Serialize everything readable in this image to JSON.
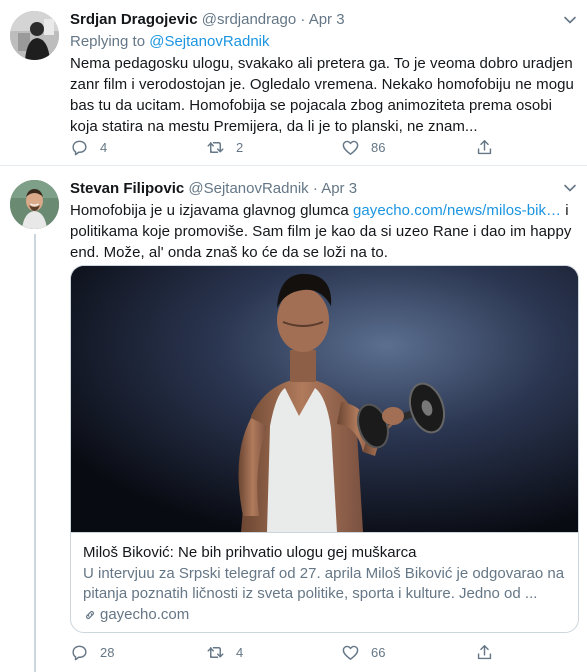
{
  "tweets": [
    {
      "name": "Srdjan Dragojevic",
      "handle": "@srdjandrago",
      "separator": "·",
      "date": "Apr 3",
      "replying_prefix": "Replying to",
      "replying_to": "@SejtanovRadnik",
      "text": "Nema pedagosku ulogu, svakako ali pretera ga. To je veoma dobro uradjen zanr film i verodostojan je. Ogledalo vremena. Nekako homofobiju ne mogu bas tu da ucitam. Homofobija se pojacala zbog animoziteta prema osobi koja statira na mestu Premijera, da li je to planski, ne znam...",
      "reply_icon": "reply-icon",
      "replies": "4",
      "retweet_icon": "retweet-icon",
      "retweets": "2",
      "like_icon": "heart-icon",
      "likes": "86",
      "share_icon": "share-icon"
    },
    {
      "name": "Stevan Filipovic",
      "handle": "@SejtanovRadnik",
      "separator": "·",
      "date": "Apr 3",
      "text_before": "Homofobija je u izjavama glavnog glumca ",
      "link": "gayecho.com/news/milos-bik…",
      "text_after": " i politikama koje promoviše. Sam film je kao da si uzeo Rane i dao im happy end. Može, al' onda znaš ko će da se loži na to.",
      "card": {
        "title": "Miloš Biković: Ne bih prihvatio ulogu gej muškarca",
        "description": "U intervjuu za Srpski telegraf od 27. aprila Miloš Biković je odgovarao na pitanja poznatih ličnosti iz sveta politike, sporta i kulture. Jedno od ...",
        "domain": "gayecho.com",
        "image": "man-lifting-dumbbell-photo"
      },
      "reply_icon": "reply-icon",
      "replies": "28",
      "retweet_icon": "retweet-icon",
      "retweets": "4",
      "like_icon": "heart-icon",
      "likes": "66",
      "share_icon": "share-icon"
    }
  ],
  "colors": {
    "link": "#1b95e0",
    "secondary_text": "#657786",
    "primary_text": "#14171a",
    "border": "#ccd6dd"
  }
}
